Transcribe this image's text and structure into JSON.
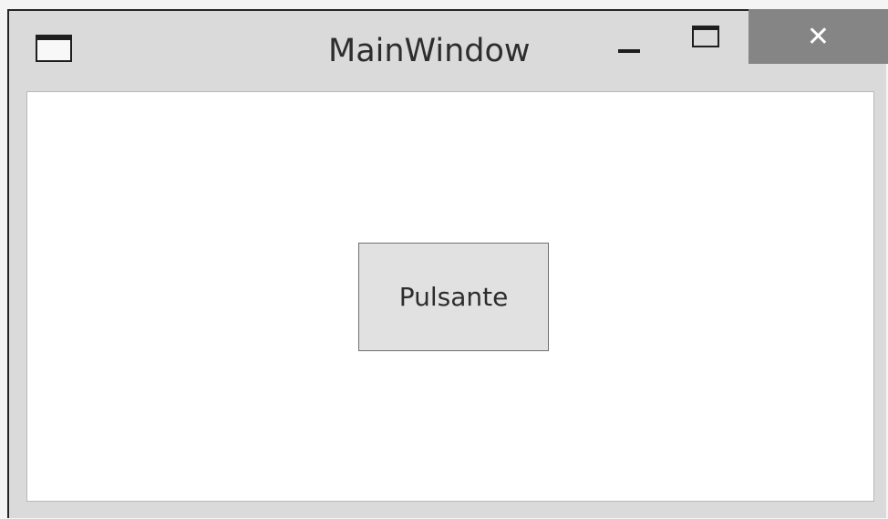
{
  "window": {
    "title": "MainWindow",
    "app_icon": "window-icon",
    "controls": {
      "minimize_icon": "minimize-icon",
      "maximize_icon": "maximize-icon",
      "close_icon": "close-icon",
      "close_glyph": "✕",
      "close_color": "#858585"
    }
  },
  "content": {
    "button_label": "Pulsante"
  }
}
